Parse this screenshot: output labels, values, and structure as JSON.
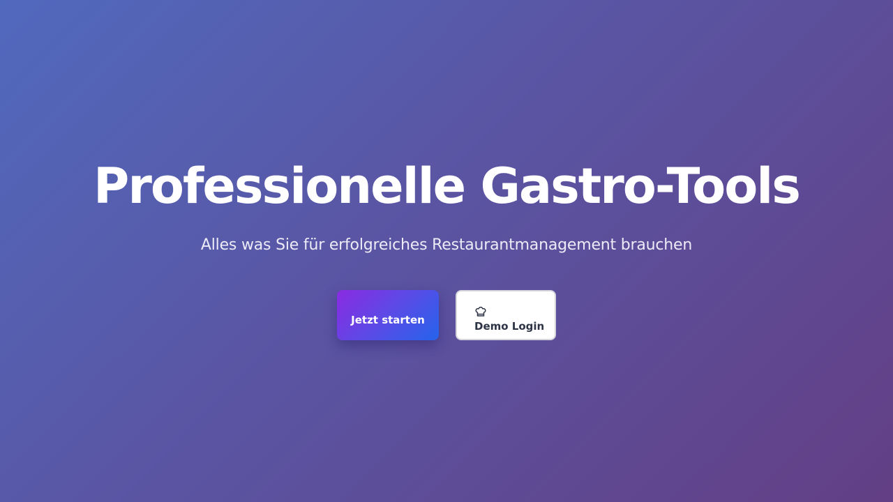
{
  "hero": {
    "title": "Professionelle Gastro-Tools",
    "subtitle": "Alles was Sie für erfolgreiches Restaurantmanagement brauchen"
  },
  "actions": {
    "start_label": "Jetzt starten",
    "demo_label": "Demo Login",
    "demo_icon": "chef-hat-icon"
  },
  "colors": {
    "background_start": "#5169bd",
    "background_end": "#633f85",
    "start_gradient_from": "#8a2be2",
    "start_gradient_to": "#2563eb",
    "demo_text": "#2d3446"
  }
}
